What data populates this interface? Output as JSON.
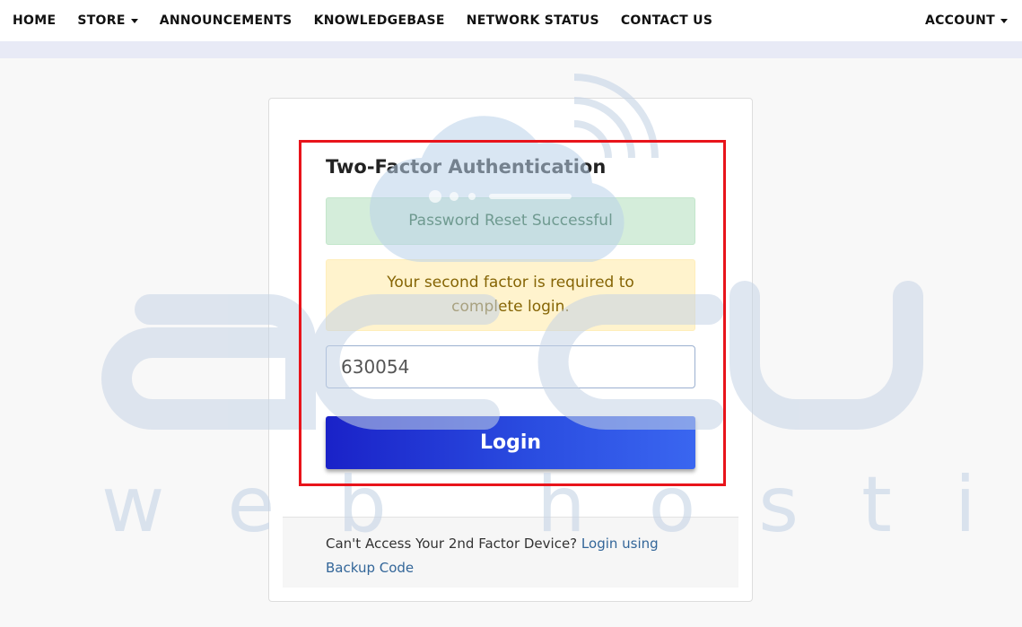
{
  "nav": {
    "items": [
      {
        "label": "HOME",
        "dropdown": false
      },
      {
        "label": "STORE",
        "dropdown": true
      },
      {
        "label": "ANNOUNCEMENTS",
        "dropdown": false
      },
      {
        "label": "KNOWLEDGEBASE",
        "dropdown": false
      },
      {
        "label": "NETWORK STATUS",
        "dropdown": false
      },
      {
        "label": "CONTACT US",
        "dropdown": false
      }
    ],
    "account_label": "ACCOUNT"
  },
  "card": {
    "title": "Two-Factor Authentication",
    "success_message": "Password Reset Successful",
    "warning_message": "Your second factor is required to complete login.",
    "code_value": "630054",
    "login_label": "Login",
    "footer_text": "Can't Access Your 2nd Factor Device?",
    "footer_link": "Login using Backup Code"
  },
  "watermark": {
    "logo_letters": "accu",
    "tagline": "web hosting"
  },
  "colors": {
    "highlight": "#e8141b",
    "button_start": "#1a22c8",
    "button_end": "#3a66f0",
    "link": "#336699"
  }
}
